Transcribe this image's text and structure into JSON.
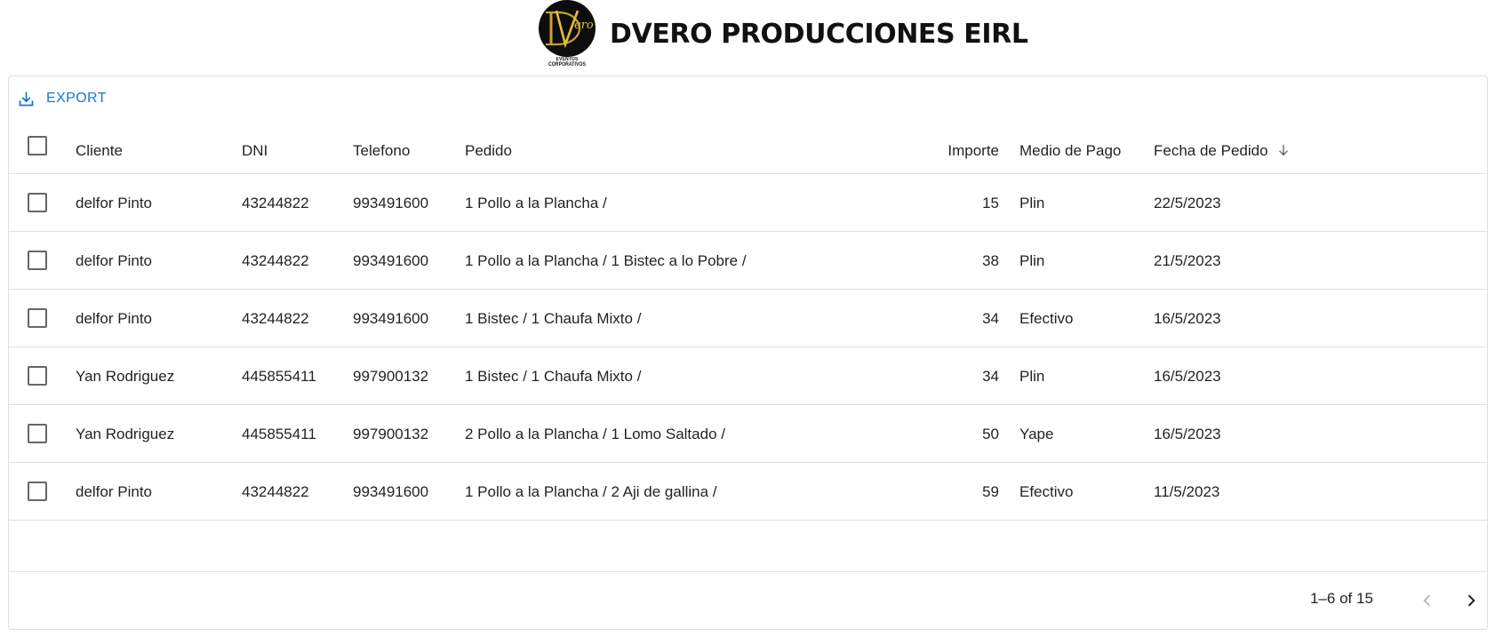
{
  "header": {
    "company_name": "DVERO PRODUCCIONES EIRL",
    "logo_tagline": "EVENTOS CORPORATIVOS"
  },
  "toolbar": {
    "export_label": "EXPORT"
  },
  "columns": {
    "cliente": "Cliente",
    "dni": "DNI",
    "telefono": "Telefono",
    "pedido": "Pedido",
    "importe": "Importe",
    "medio_pago": "Medio de Pago",
    "fecha_pedido": "Fecha de Pedido"
  },
  "rows": [
    {
      "cliente": "delfor Pinto",
      "dni": "43244822",
      "telefono": "993491600",
      "pedido": "1 Pollo a la Plancha /",
      "importe": "15",
      "medio_pago": "Plin",
      "fecha": "22/5/2023"
    },
    {
      "cliente": "delfor Pinto",
      "dni": "43244822",
      "telefono": "993491600",
      "pedido": "1 Pollo a la Plancha / 1 Bistec a lo Pobre /",
      "importe": "38",
      "medio_pago": "Plin",
      "fecha": "21/5/2023"
    },
    {
      "cliente": "delfor Pinto",
      "dni": "43244822",
      "telefono": "993491600",
      "pedido": "1 Bistec / 1 Chaufa Mixto /",
      "importe": "34",
      "medio_pago": "Efectivo",
      "fecha": "16/5/2023"
    },
    {
      "cliente": "Yan Rodriguez",
      "dni": "445855411",
      "telefono": "997900132",
      "pedido": "1 Bistec / 1 Chaufa Mixto /",
      "importe": "34",
      "medio_pago": "Plin",
      "fecha": "16/5/2023"
    },
    {
      "cliente": "Yan Rodriguez",
      "dni": "445855411",
      "telefono": "997900132",
      "pedido": "2 Pollo a la Plancha / 1 Lomo Saltado /",
      "importe": "50",
      "medio_pago": "Yape",
      "fecha": "16/5/2023"
    },
    {
      "cliente": "delfor Pinto",
      "dni": "43244822",
      "telefono": "993491600",
      "pedido": "1 Pollo a la Plancha / 2 Aji de gallina /",
      "importe": "59",
      "medio_pago": "Efectivo",
      "fecha": "11/5/2023"
    }
  ],
  "pagination": {
    "range_label": "1–6 of 15"
  },
  "sort": {
    "column": "fecha_pedido",
    "direction": "descending"
  },
  "colors": {
    "accent": "#1976d2",
    "border": "#e0e0e0",
    "logo_gold": "#c9a227"
  },
  "icons": {
    "export": "download-icon",
    "sort": "arrow-down-icon",
    "prev": "chevron-left-icon",
    "next": "chevron-right-icon"
  }
}
